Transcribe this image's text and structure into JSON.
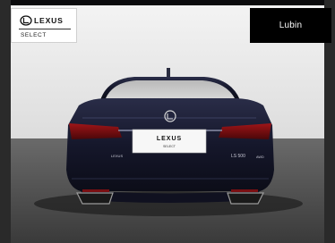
{
  "brand": {
    "logo_text": "LEXUS",
    "select_label": "SELECT"
  },
  "dealer": {
    "name": "Lubin"
  },
  "vehicle": {
    "plate_brand": "LEXUS",
    "plate_sub": "SELECT",
    "badge_model": "LS 500",
    "badge_trim": "AWD",
    "badge_left": "LEXUS"
  },
  "colors": {
    "car_body": "#15172b",
    "studio_floor": "#4a4a4a",
    "studio_wall": "#eeeeee",
    "dealer_badge": "#000000",
    "taillight": "#7a0f12"
  }
}
